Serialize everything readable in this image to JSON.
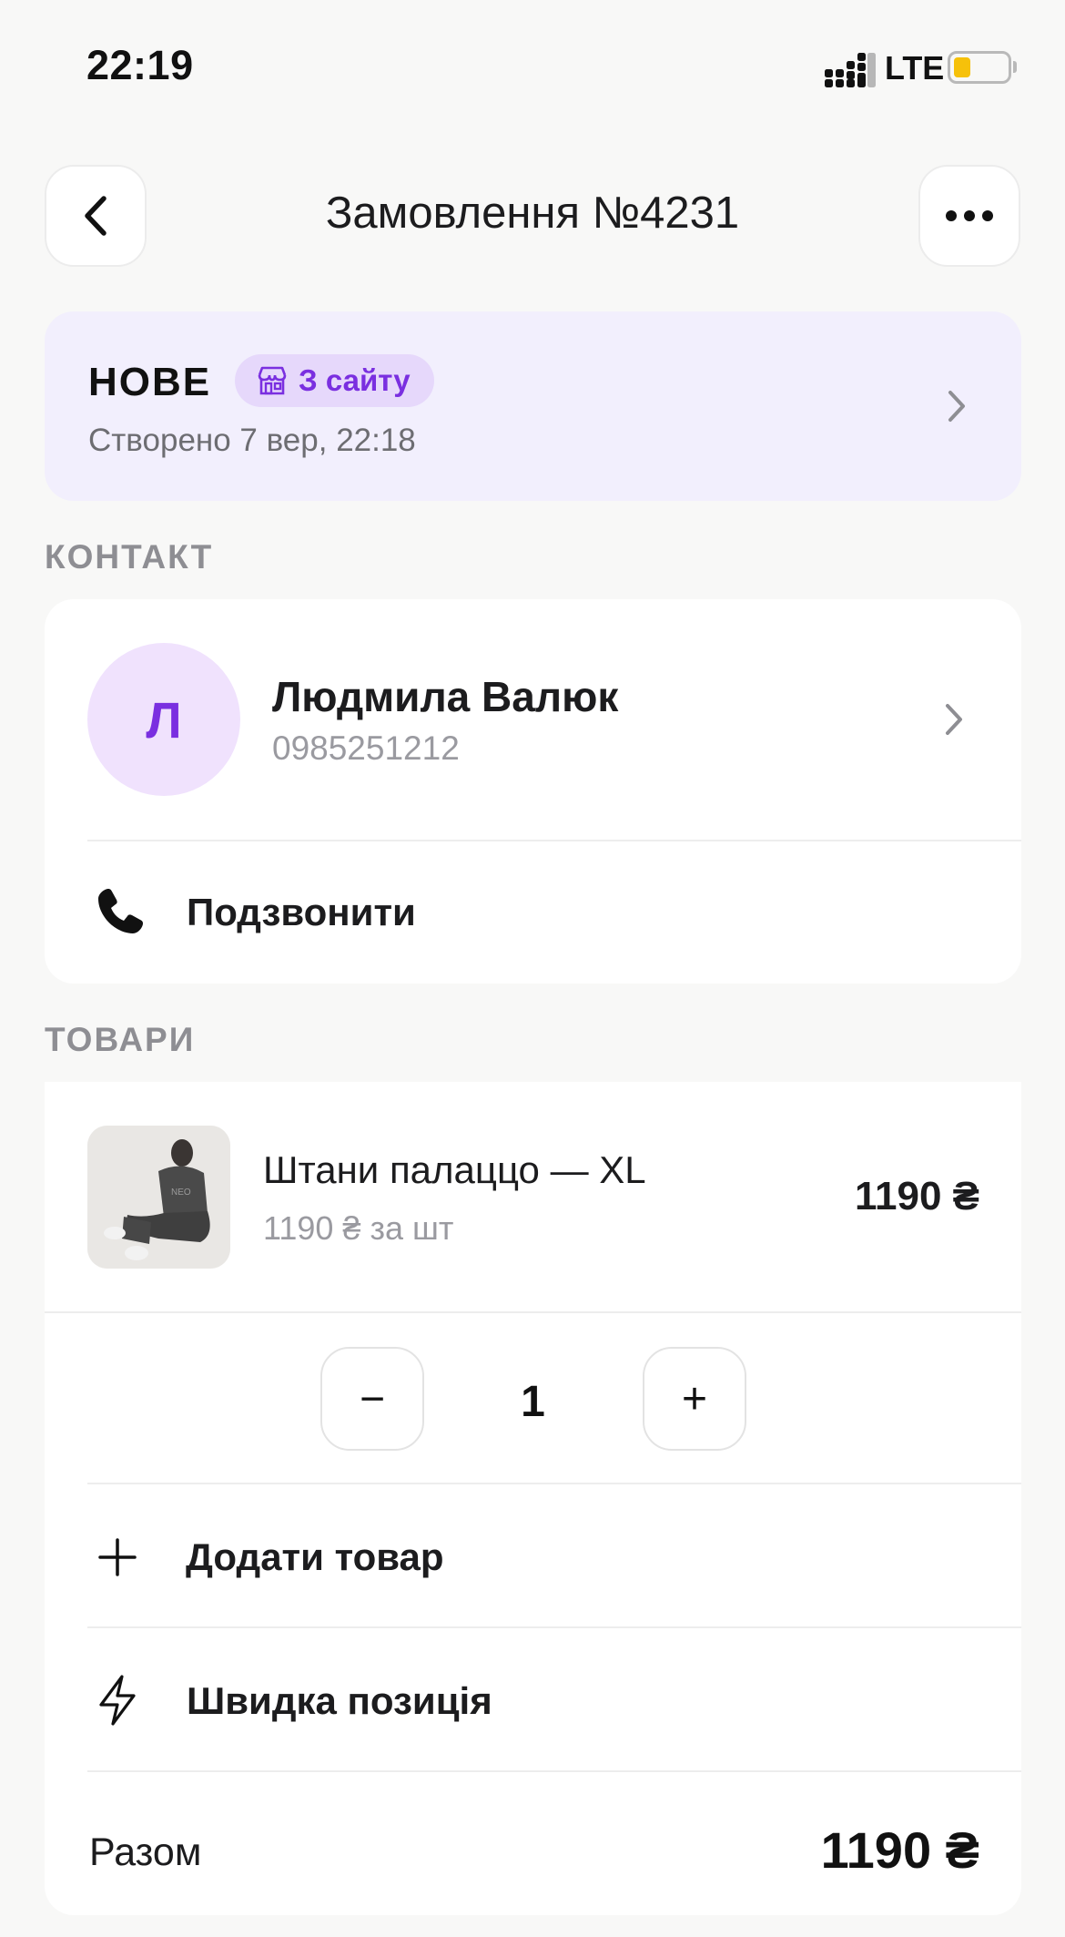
{
  "status_bar": {
    "time": "22:19",
    "network": "LTE"
  },
  "header": {
    "title": "Замовлення №4231"
  },
  "order_status": {
    "label": "НОВЕ",
    "source": "З сайту",
    "created": "Створено 7 вер, 22:18"
  },
  "contact_section": {
    "heading": "КОНТАКТ",
    "avatar_letter": "Л",
    "name": "Людмила Валюк",
    "phone": "0985251212",
    "call_label": "Подзвонити"
  },
  "goods_section": {
    "heading": "ТОВАРИ",
    "item": {
      "name": "Штани палаццо — XL",
      "unit_price": "1190 ₴ за шт",
      "total": "1190 ₴",
      "quantity": "1",
      "minus": "−",
      "plus": "+"
    },
    "add_item": "Додати товар",
    "quick_item": "Швидка позиція",
    "total_label": "Разом",
    "total_value": "1190 ₴"
  },
  "colors": {
    "accent": "#7a2fe0",
    "status_bg": "#f2effd",
    "badge_bg": "#e6d8fb",
    "avatar_bg": "#f0e2fd",
    "background": "#f8f8f7"
  },
  "icons": {
    "back": "chevron-left-icon",
    "more": "ellipsis-icon",
    "source": "store-icon",
    "call": "phone-icon",
    "add": "plus-icon",
    "quick": "lightning-icon"
  }
}
